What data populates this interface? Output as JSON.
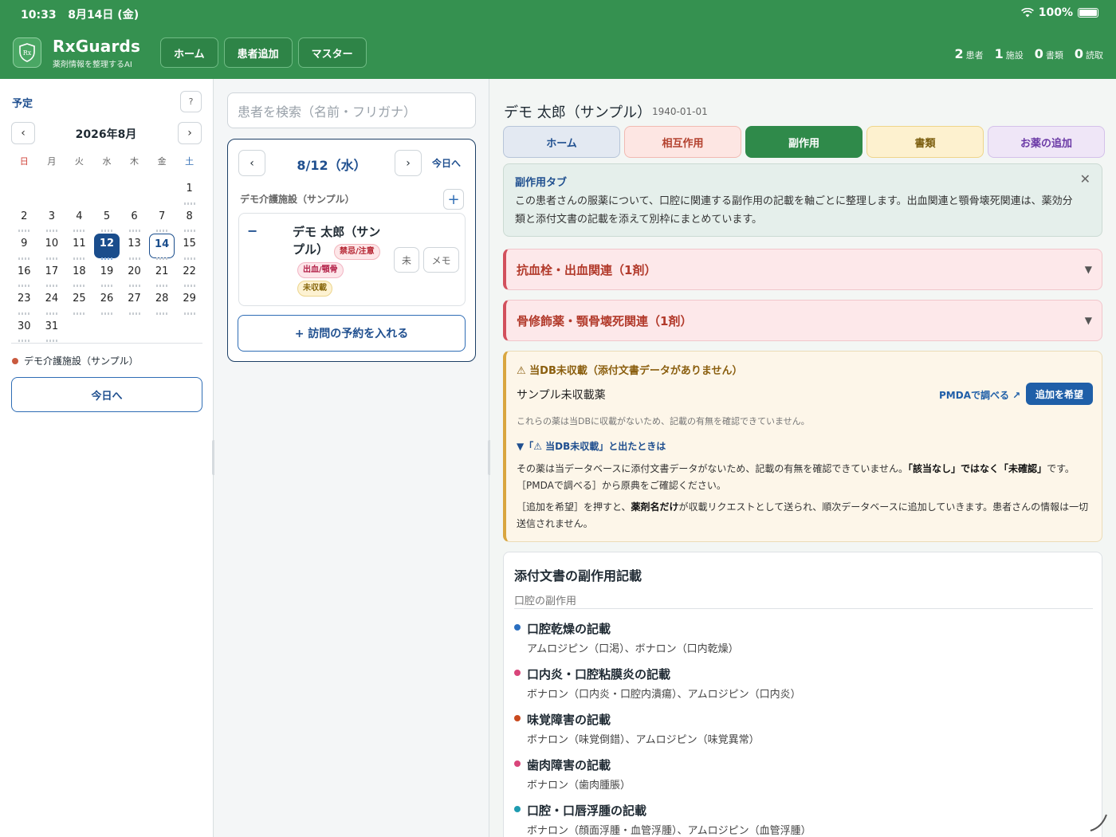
{
  "status_bar": {
    "time": "10:33",
    "date": "8月14日 (金)",
    "battery": "100%"
  },
  "header": {
    "app_name": "RxGuards",
    "app_subtitle": "薬剤情報を整理するAI",
    "nav": [
      "ホーム",
      "患者追加",
      "マスター"
    ],
    "stats": [
      {
        "value": "2",
        "label": "患者"
      },
      {
        "value": "1",
        "label": "施設"
      },
      {
        "value": "0",
        "label": "書類"
      },
      {
        "value": "0",
        "label": "読取"
      }
    ]
  },
  "calendar": {
    "title": "予定",
    "month_label": "2026年8月",
    "weekdays": [
      "日",
      "月",
      "火",
      "水",
      "木",
      "金",
      "土"
    ],
    "weeks": [
      [
        "",
        "",
        "",
        "",
        "",
        "",
        "1"
      ],
      [
        "2",
        "3",
        "4",
        "5",
        "6",
        "7",
        "8"
      ],
      [
        "9",
        "10",
        "11",
        "12",
        "13",
        "14",
        "15"
      ],
      [
        "16",
        "17",
        "18",
        "19",
        "20",
        "21",
        "22"
      ],
      [
        "23",
        "24",
        "25",
        "26",
        "27",
        "28",
        "29"
      ],
      [
        "30",
        "31",
        "",
        "",
        "",
        "",
        ""
      ]
    ],
    "selected_day": "12",
    "today_day": "14",
    "facility_legend": "デモ介護施設（サンプル）",
    "today_button": "今日へ"
  },
  "schedule": {
    "search_placeholder": "患者を検索（名前・フリガナ）",
    "day_label": "8/12（水）",
    "today_link": "今日へ",
    "facility_name": "デモ介護施設（サンプル）",
    "patient": {
      "name": "デモ 太郎（サンプル）",
      "badges": [
        "禁忌/注意",
        "出血/顎骨",
        "未収載"
      ],
      "status_button": "未",
      "memo_button": "メモ"
    },
    "book_button": "+ 訪問の予約を入れる"
  },
  "patient_detail": {
    "name": "デモ 太郎（サンプル）",
    "dob": "1940-01-01",
    "tabs": [
      "ホーム",
      "相互作用",
      "副作用",
      "書類",
      "お薬の追加"
    ],
    "active_tab": "副作用",
    "info": {
      "title": "副作用タブ",
      "text": "この患者さんの服薬について、口腔に関連する副作用の記載を軸ごとに整理します。出血関連と顎骨壊死関連は、薬効分類と添付文書の記載を添えて別枠にまとめています。"
    },
    "accordions": [
      {
        "title": "抗血栓・出血関連（1剤）"
      },
      {
        "title": "骨修飾薬・顎骨壊死関連（1剤）"
      }
    ],
    "warning": {
      "title": "⚠ 当DB未収載（添付文書データがありません）",
      "drug": "サンプル未収載薬",
      "pmda_link": "PMDAで調べる ↗",
      "request_button": "追加を希望",
      "note": "これらの薬は当DBに収載がないため、記載の有無を確認できていません。",
      "subheading": "▼「⚠ 当DB未収載」と出たときは",
      "p1_a": "その薬は当データベースに添付文書データがないため、記載の有無を確認できていません。",
      "p1_b": "「該当なし」ではなく「未確認」",
      "p1_c": "です。［PMDAで調べる］から原典をご確認ください。",
      "p2_a": "［追加を希望］を押すと、",
      "p2_b": "薬剤名だけ",
      "p2_c": "が収載リクエストとして送られ、順次データベースに追加していきます。患者さんの情報は一切送信されません。"
    },
    "side_effects": {
      "title": "添付文書の副作用記載",
      "subtitle": "口腔の副作用",
      "items": [
        {
          "name": "口腔乾燥の記載",
          "detail": "アムロジピン（口渇）、ボナロン（口内乾燥）",
          "color": "#2a6fc0"
        },
        {
          "name": "口内炎・口腔粘膜炎の記載",
          "detail": "ボナロン（口内炎・口腔内潰瘍）、アムロジピン（口内炎）",
          "color": "#d9457a"
        },
        {
          "name": "味覚障害の記載",
          "detail": "ボナロン（味覚倒錯）、アムロジピン（味覚異常）",
          "color": "#c94a1f"
        },
        {
          "name": "歯肉障害の記載",
          "detail": "ボナロン（歯肉腫脹）",
          "color": "#d9457a"
        },
        {
          "name": "口腔・口唇浮腫の記載",
          "detail": "ボナロン（顔面浮腫・血管浮腫）、アムロジピン（血管浮腫）",
          "color": "#1e9bb0"
        }
      ]
    }
  }
}
